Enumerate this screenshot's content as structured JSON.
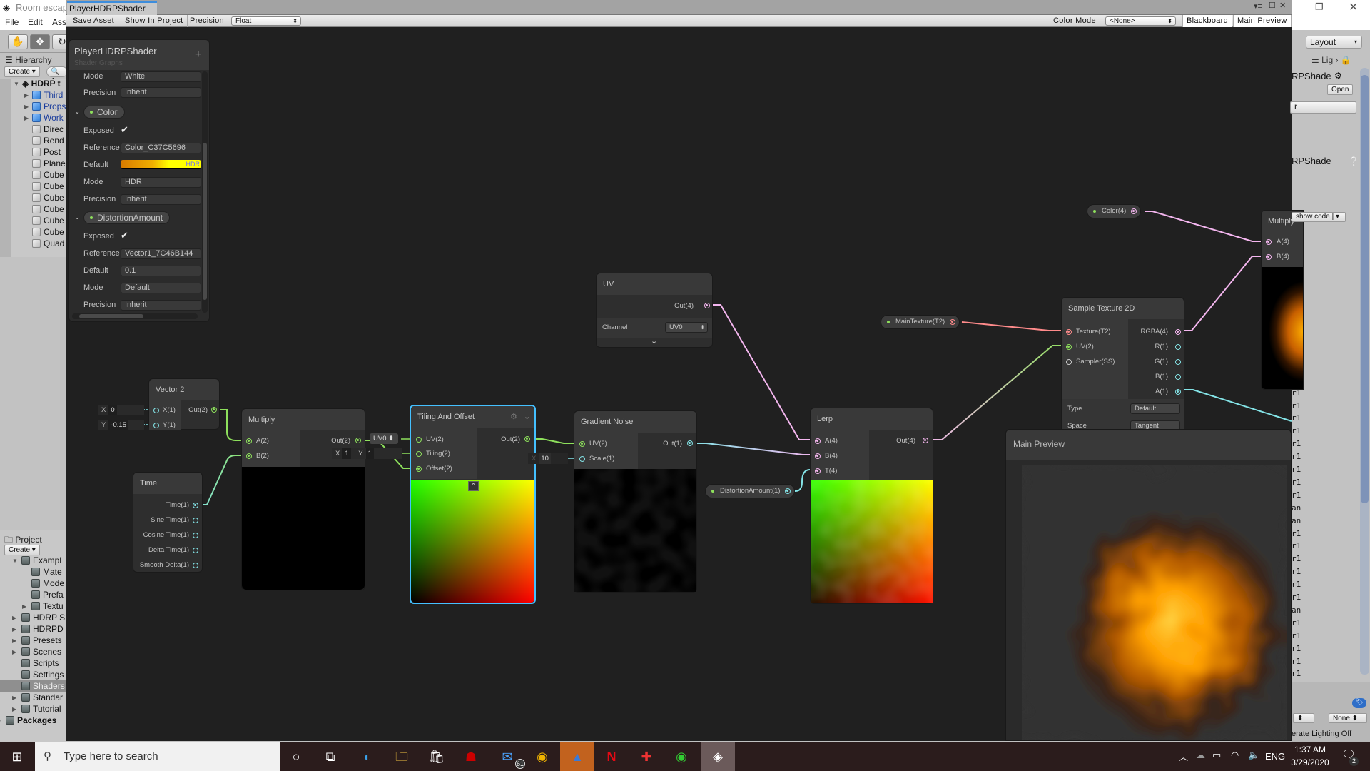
{
  "app": {
    "title": "Room escap",
    "menu": [
      "File",
      "Edit",
      "Ass"
    ],
    "tools": [
      "hand-tool",
      "move-tool",
      "rotate-tool"
    ]
  },
  "hierarchy": {
    "tab": "Hierarchy",
    "create": "Create",
    "search_placeholder": "A",
    "scene": "HDRP t",
    "items": [
      {
        "label": "Third",
        "type": "prefab",
        "expandable": true
      },
      {
        "label": "Props",
        "type": "prefab",
        "expandable": true
      },
      {
        "label": "Work",
        "type": "prefab",
        "expandable": true
      },
      {
        "label": "Direc",
        "type": "gameobject"
      },
      {
        "label": "Rend",
        "type": "gameobject"
      },
      {
        "label": "Post",
        "type": "gameobject"
      },
      {
        "label": "Plane",
        "type": "gameobject"
      },
      {
        "label": "Cube",
        "type": "gameobject"
      },
      {
        "label": "Cube",
        "type": "gameobject"
      },
      {
        "label": "Cube",
        "type": "gameobject"
      },
      {
        "label": "Cube",
        "type": "gameobject"
      },
      {
        "label": "Cube",
        "type": "gameobject"
      },
      {
        "label": "Cube",
        "type": "gameobject"
      },
      {
        "label": "Quad",
        "type": "gameobject"
      }
    ]
  },
  "project": {
    "tab": "Project",
    "create": "Create",
    "items": [
      {
        "label": "Exampl",
        "depth": 1,
        "arrow": "open"
      },
      {
        "label": "Mate",
        "depth": 2
      },
      {
        "label": "Mode",
        "depth": 2
      },
      {
        "label": "Prefa",
        "depth": 2
      },
      {
        "label": "Textu",
        "depth": 2,
        "arrow": "closed"
      },
      {
        "label": "HDRP S",
        "depth": 1,
        "arrow": "closed"
      },
      {
        "label": "HDRPD",
        "depth": 1,
        "arrow": "closed"
      },
      {
        "label": "Presets",
        "depth": 1,
        "arrow": "closed"
      },
      {
        "label": "Scenes",
        "depth": 1,
        "arrow": "closed"
      },
      {
        "label": "Scripts",
        "depth": 1
      },
      {
        "label": "Settings",
        "depth": 1
      },
      {
        "label": "Shaders",
        "depth": 1,
        "selected": true
      },
      {
        "label": "Standar",
        "depth": 1,
        "arrow": "closed"
      },
      {
        "label": "Tutorial",
        "depth": 1,
        "arrow": "closed"
      },
      {
        "label": "Packages",
        "depth": 0,
        "arrow": "closed",
        "bold": true
      }
    ]
  },
  "shader_window": {
    "tab": "PlayerHDRPShader",
    "toolbar": {
      "save_asset": "Save Asset",
      "show_in_project": "Show In Project",
      "precision_label": "Precision",
      "precision_value": "Float",
      "color_mode_label": "Color Mode",
      "color_mode_value": "<None>",
      "blackboard": "Blackboard",
      "main_preview": "Main Preview"
    }
  },
  "blackboard": {
    "title": "PlayerHDRPShader",
    "subtitle": "Shader Graphs",
    "add": "+",
    "top_rows": [
      {
        "label": "Mode",
        "value": "White"
      },
      {
        "label": "Precision",
        "value": "Inherit"
      }
    ],
    "properties": [
      {
        "name": "Color",
        "exposed": true,
        "rows": [
          {
            "label": "Reference",
            "value": "Color_C37C5696"
          },
          {
            "label": "Default",
            "value": "HDR",
            "color": "#f0a000"
          },
          {
            "label": "Mode",
            "value": "HDR"
          },
          {
            "label": "Precision",
            "value": "Inherit"
          }
        ],
        "exposed_label": "Exposed"
      },
      {
        "name": "DistortionAmount",
        "exposed": true,
        "rows": [
          {
            "label": "Reference",
            "value": "Vector1_7C46B144"
          },
          {
            "label": "Default",
            "value": "0.1"
          },
          {
            "label": "Mode",
            "value": "Default"
          },
          {
            "label": "Precision",
            "value": "Inherit"
          }
        ],
        "exposed_label": "Exposed"
      }
    ]
  },
  "nodes": {
    "vector2": {
      "title": "Vector 2",
      "inputs": [
        "X(1)",
        "Y(1)"
      ],
      "output": "Out(2)",
      "x_label": "X",
      "x_value": "0",
      "y_label": "Y",
      "y_value": "-0.15"
    },
    "multiply": {
      "title": "Multiply",
      "inputs": [
        "A(2)",
        "B(2)"
      ],
      "output": "Out(2)"
    },
    "time": {
      "title": "Time",
      "outputs": [
        "Time(1)",
        "Sine Time(1)",
        "Cosine Time(1)",
        "Delta Time(1)",
        "Smooth Delta(1)"
      ]
    },
    "tiling_offset": {
      "title": "Tiling And Offset",
      "inputs": [
        "UV(2)",
        "Tiling(2)",
        "Offset(2)"
      ],
      "output": "Out(2)",
      "uv_inline": "UV0",
      "tiling_x_label": "X",
      "tiling_x": "1",
      "tiling_y_label": "Y",
      "tiling_y": "1"
    },
    "gradient_noise": {
      "title": "Gradient Noise",
      "inputs": [
        "UV(2)",
        "Scale(1)"
      ],
      "output": "Out(1)",
      "scale_label": "X",
      "scale_value": "10"
    },
    "uv": {
      "title": "UV",
      "output": "Out(4)",
      "channel_label": "Channel",
      "channel_value": "UV0"
    },
    "lerp": {
      "title": "Lerp",
      "inputs": [
        "A(4)",
        "B(4)",
        "T(4)"
      ],
      "output": "Out(4)"
    },
    "sample_texture": {
      "title": "Sample Texture 2D",
      "inputs": [
        "Texture(T2)",
        "UV(2)",
        "Sampler(SS)"
      ],
      "outputs": [
        "RGBA(4)",
        "R(1)",
        "G(1)",
        "B(1)",
        "A(1)"
      ],
      "type_label": "Type",
      "type_value": "Default",
      "space_label": "Space",
      "space_value": "Tangent"
    },
    "multiply2": {
      "title": "Multiply",
      "inputs": [
        "A(4)",
        "B(4)"
      ]
    },
    "main_texture_pill": "MainTexture(T2)",
    "color_pill": "Color(4)",
    "distortion_pill": "DistortionAmount(1)",
    "main_preview": {
      "title": "Main Preview"
    }
  },
  "edge_colors": {
    "vector1": "#84e4e7",
    "vector2": "#8ee05c",
    "vector4": "#f4b6ef",
    "texture": "#ff8b8b"
  },
  "inspector": {
    "layout": "Layout",
    "tab": "Lig",
    "asset_name": "RPShade",
    "open": "Open",
    "field": "r",
    "asset_name2": "RPShade",
    "show_code": "show code",
    "list": [
      "r",
      "r1",
      "r1",
      "r1",
      "r1",
      "r1",
      "r1",
      "r1",
      "r1",
      "r1",
      "r1",
      "r1",
      "r1",
      "an",
      "an",
      "r1",
      "r1",
      "r1",
      "r1",
      "r1",
      "r1",
      "an",
      "r1",
      "r1",
      "r1",
      "r1",
      "r1"
    ],
    "none_dropdown": "None",
    "status": "erate Lighting Off"
  },
  "taskbar": {
    "search_placeholder": "Type here to search",
    "apps": [
      "cortana",
      "task-view",
      "edge",
      "file-explorer",
      "store",
      "game-app",
      "mail",
      "chrome",
      "app-orange",
      "netflix",
      "app-red",
      "chrome-profile",
      "unity"
    ],
    "mail_badge": "61",
    "lang": "ENG",
    "time": "1:37 AM",
    "date": "3/29/2020",
    "notifications": "2"
  }
}
